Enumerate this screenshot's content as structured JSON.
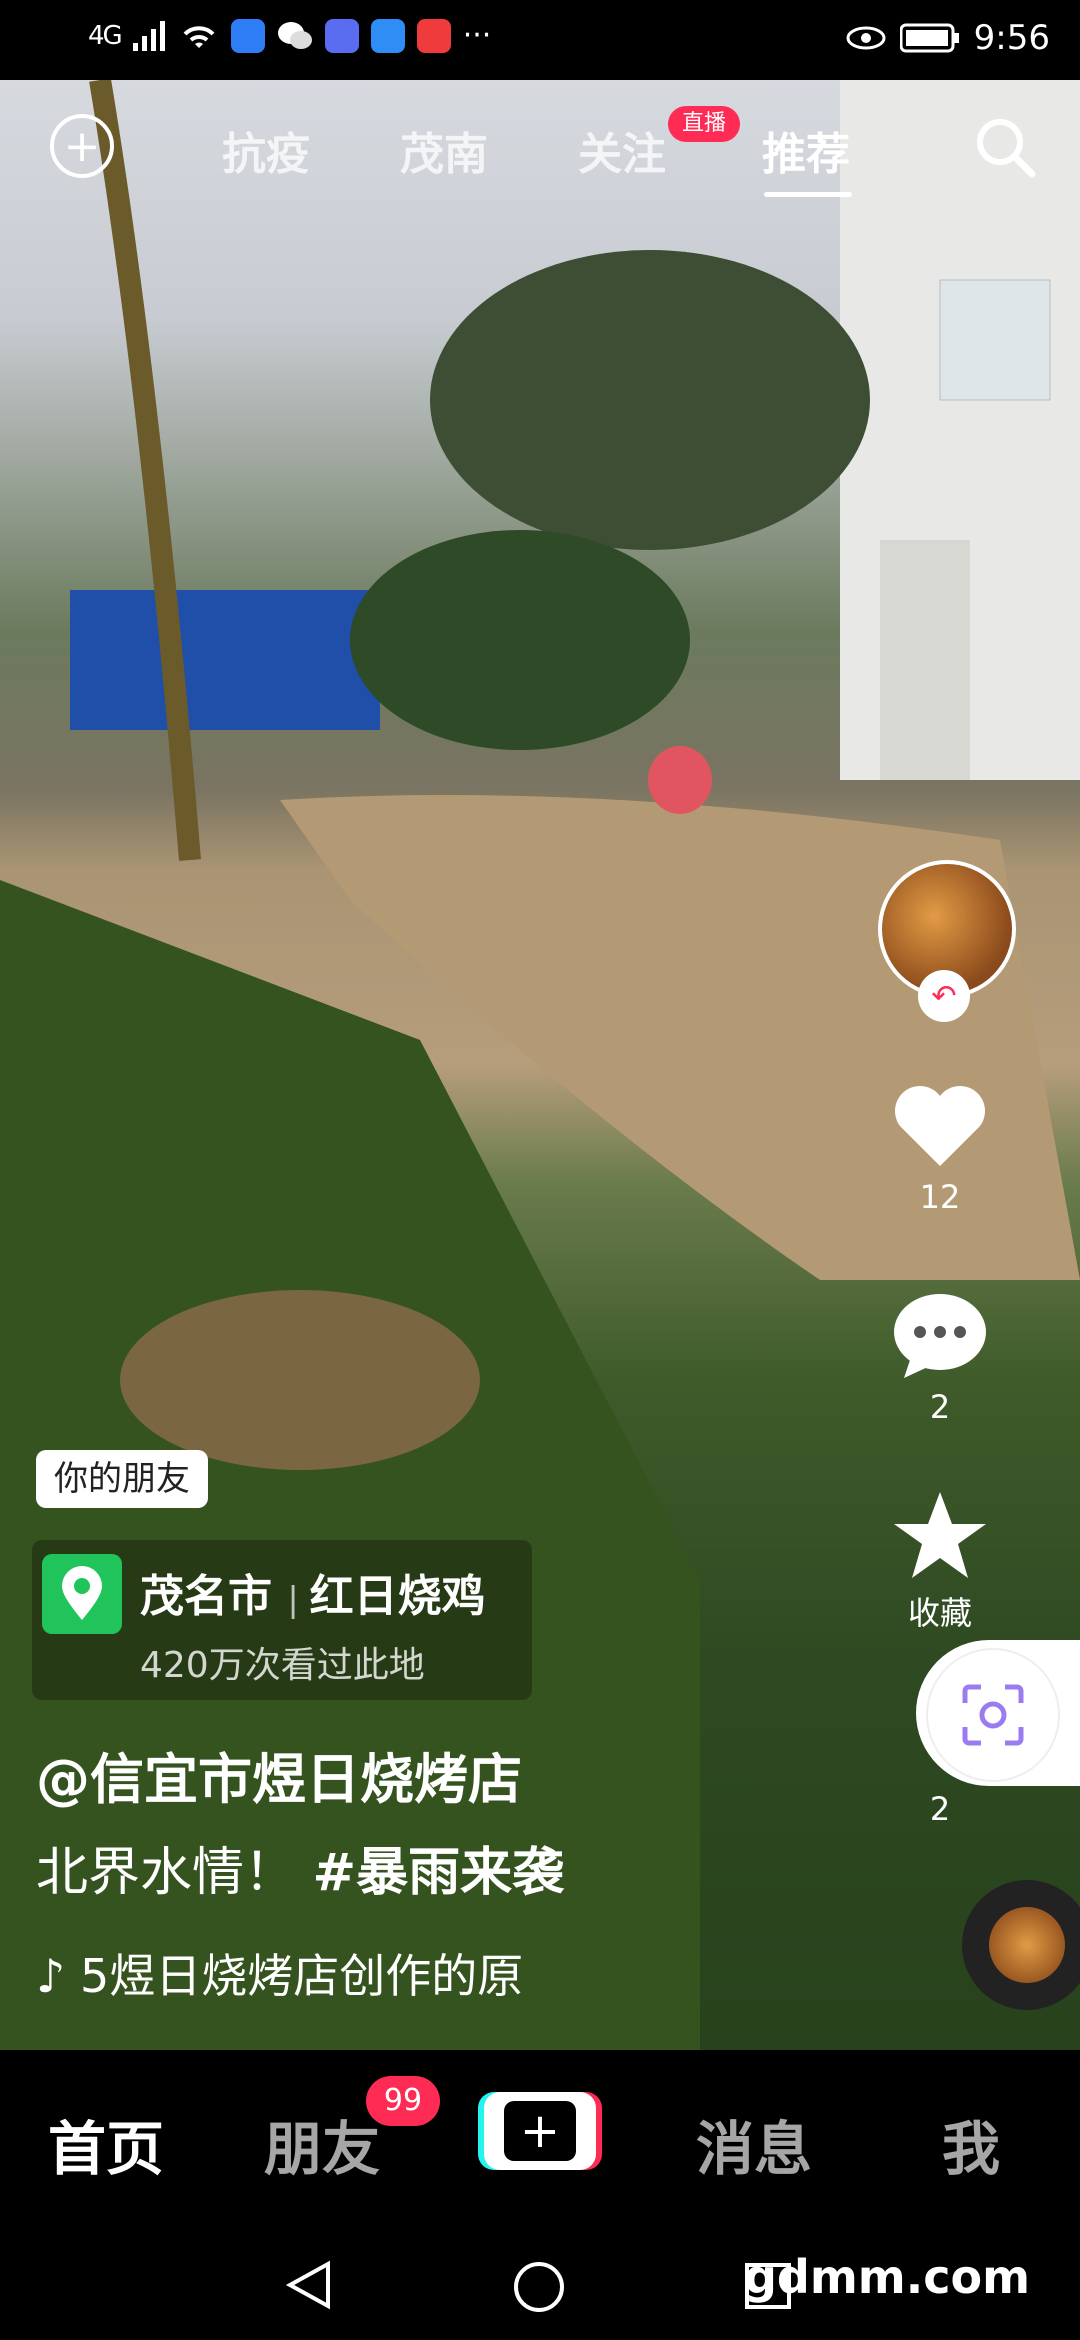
{
  "status_bar": {
    "network": "4G",
    "time": "9:56"
  },
  "top_tabs": {
    "tabs": [
      "抗疫",
      "茂南",
      "关注",
      "推荐"
    ],
    "live_badge": "直播",
    "active": "推荐"
  },
  "rail": {
    "likes": "12",
    "comments": "2",
    "favorite_label": "收藏",
    "shares": "2"
  },
  "video_info": {
    "friend_tag": "你的朋友",
    "location_title": "茂名市",
    "location_detail": "红日烧鸡",
    "location_sub": "420万次看过此地",
    "author": "@信宜市煜日烧烤店",
    "desc_text": "北界水情！",
    "desc_hashtag": "#暴雨来袭",
    "music": "♪ 5煜日烧烤店创作的原"
  },
  "bottom_nav": {
    "home": "首页",
    "friends": "朋友",
    "friends_badge": "99",
    "add": "+",
    "messages": "消息",
    "me": "我"
  },
  "watermark": "gdmm.com",
  "colors": {
    "accent": "#fe2c55",
    "location_green": "#21c45a"
  }
}
